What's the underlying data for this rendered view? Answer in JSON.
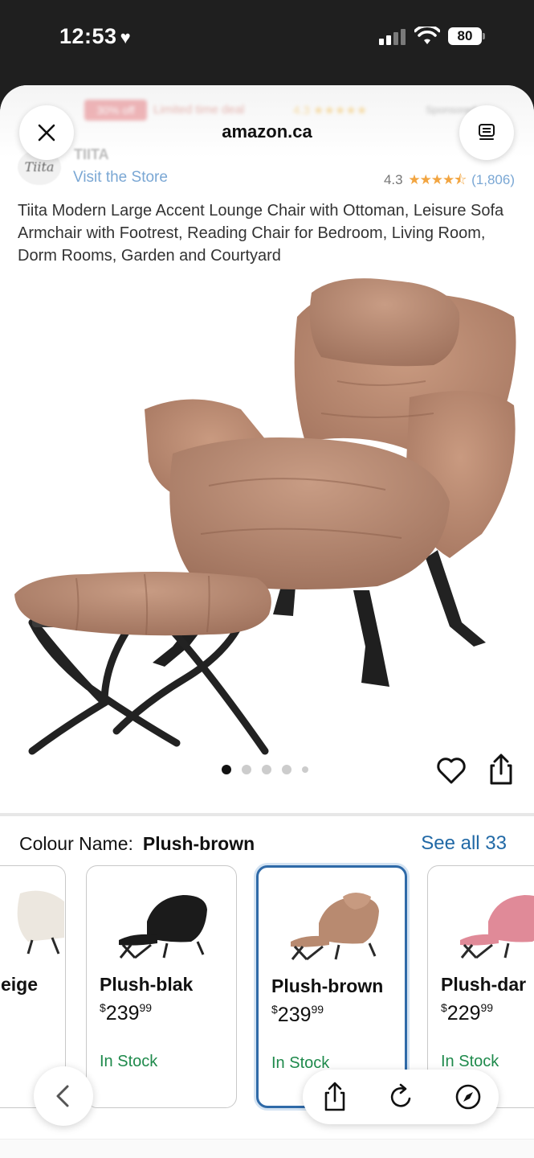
{
  "status_bar": {
    "time": "12:53",
    "heart_icon": "heart-icon",
    "battery": "80"
  },
  "header": {
    "site": "amazon.ca",
    "close_icon": "close-icon",
    "reader_icon": "reader-icon"
  },
  "background_header": {
    "badge": "30% off",
    "deal_text": "Limited time deal",
    "rating": "4.3",
    "sponsored": "Sponsored"
  },
  "brand": {
    "logo_text": "Tiita",
    "name": "TIITA",
    "visit_store": "Visit the Store",
    "rating": "4.3",
    "stars": "★★★★⯪",
    "review_count": "(1,806)"
  },
  "product": {
    "title": "Tiita Modern Large Accent Lounge Chair with Ottoman, Leisure Sofa Armchair with Footrest, Reading Chair for Bedroom, Living Room, Dorm Rooms, Garden and Courtyard",
    "image_dots": 5,
    "active_dot": 0
  },
  "colour": {
    "label": "Colour Name:",
    "selected": "Plush-brown",
    "see_all": "See all 33"
  },
  "variants": [
    {
      "name": "eige",
      "price_whole": "",
      "price_cents": "",
      "stock": "",
      "color": "#ece7df",
      "leg": "#2a2a2a"
    },
    {
      "name": "Plush-blak",
      "price_whole": "239",
      "price_cents": "99",
      "currency": "$",
      "stock": "In Stock",
      "color": "#1b1b1b",
      "leg": "#222"
    },
    {
      "name": "Plush-brown",
      "price_whole": "239",
      "price_cents": "99",
      "currency": "$",
      "stock": "In Stock",
      "color": "#b88a70",
      "leg": "#2a2a2a",
      "selected": true
    },
    {
      "name": "Plush-dar",
      "price_whole": "229",
      "price_cents": "99",
      "currency": "$",
      "stock": "In Stock",
      "color": "#e08a98",
      "leg": "#2a2a2a"
    }
  ],
  "toolbar": {
    "back_icon": "chevron-left-icon",
    "share_icon": "share-icon",
    "reload_icon": "reload-icon",
    "compass_icon": "compass-icon"
  },
  "colors": {
    "link": "#2169a6",
    "in_stock": "#1f8a4c",
    "selected_border": "#2f6aa8",
    "chair": "#b88a70",
    "star": "#f2a541"
  }
}
